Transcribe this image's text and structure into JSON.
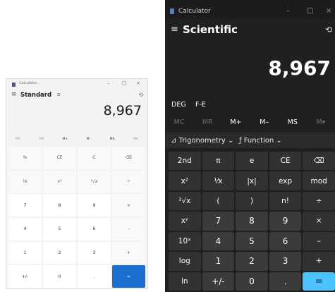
{
  "standard_window": {
    "title": "Calculator",
    "caption": {
      "minimize": "–",
      "maximize": "□",
      "close": "×"
    },
    "menu_icon": "≡",
    "mode": "Standard",
    "keep_on_top_icon": "⧉",
    "history_icon": "⟲",
    "display": "8,967",
    "memory": [
      "MC",
      "MR",
      "M+",
      "M–",
      "MS",
      "M▾"
    ],
    "keys": [
      "%",
      "CE",
      "C",
      "⌫",
      "⅟x",
      "x²",
      "²√x",
      "÷",
      "7",
      "8",
      "9",
      "×",
      "4",
      "5",
      "6",
      "–",
      "1",
      "2",
      "3",
      "+",
      "+/-",
      "0",
      ".",
      "="
    ]
  },
  "scientific_window": {
    "title": "Calculator",
    "caption": {
      "minimize": "–",
      "maximize": "□",
      "close": "×"
    },
    "menu_icon": "≡",
    "mode": "Scientific",
    "history_icon": "⟲",
    "display": "8,967",
    "angle_unit": "DEG",
    "fe": "F-E",
    "memory": [
      "MC",
      "MR",
      "M+",
      "M–",
      "MS",
      "M▾"
    ],
    "trig_label": "⊿ Trigonometry ⌄",
    "function_label": "ƒ Function ⌄",
    "keys": [
      "2nd",
      "π",
      "e",
      "CE",
      "⌫",
      "x²",
      "⅟x",
      "|x|",
      "exp",
      "mod",
      "²√x",
      "(",
      ")",
      "n!",
      "÷",
      "xʸ",
      "7",
      "8",
      "9",
      "×",
      "10ˣ",
      "4",
      "5",
      "6",
      "–",
      "log",
      "1",
      "2",
      "3",
      "+",
      "ln",
      "+/-",
      "0",
      ".",
      "="
    ]
  },
  "colors": {
    "light_bg": "#f3f3f3",
    "dark_bg": "#202020",
    "light_accent": "#1a6fd1",
    "dark_accent": "#4cc2ff"
  }
}
